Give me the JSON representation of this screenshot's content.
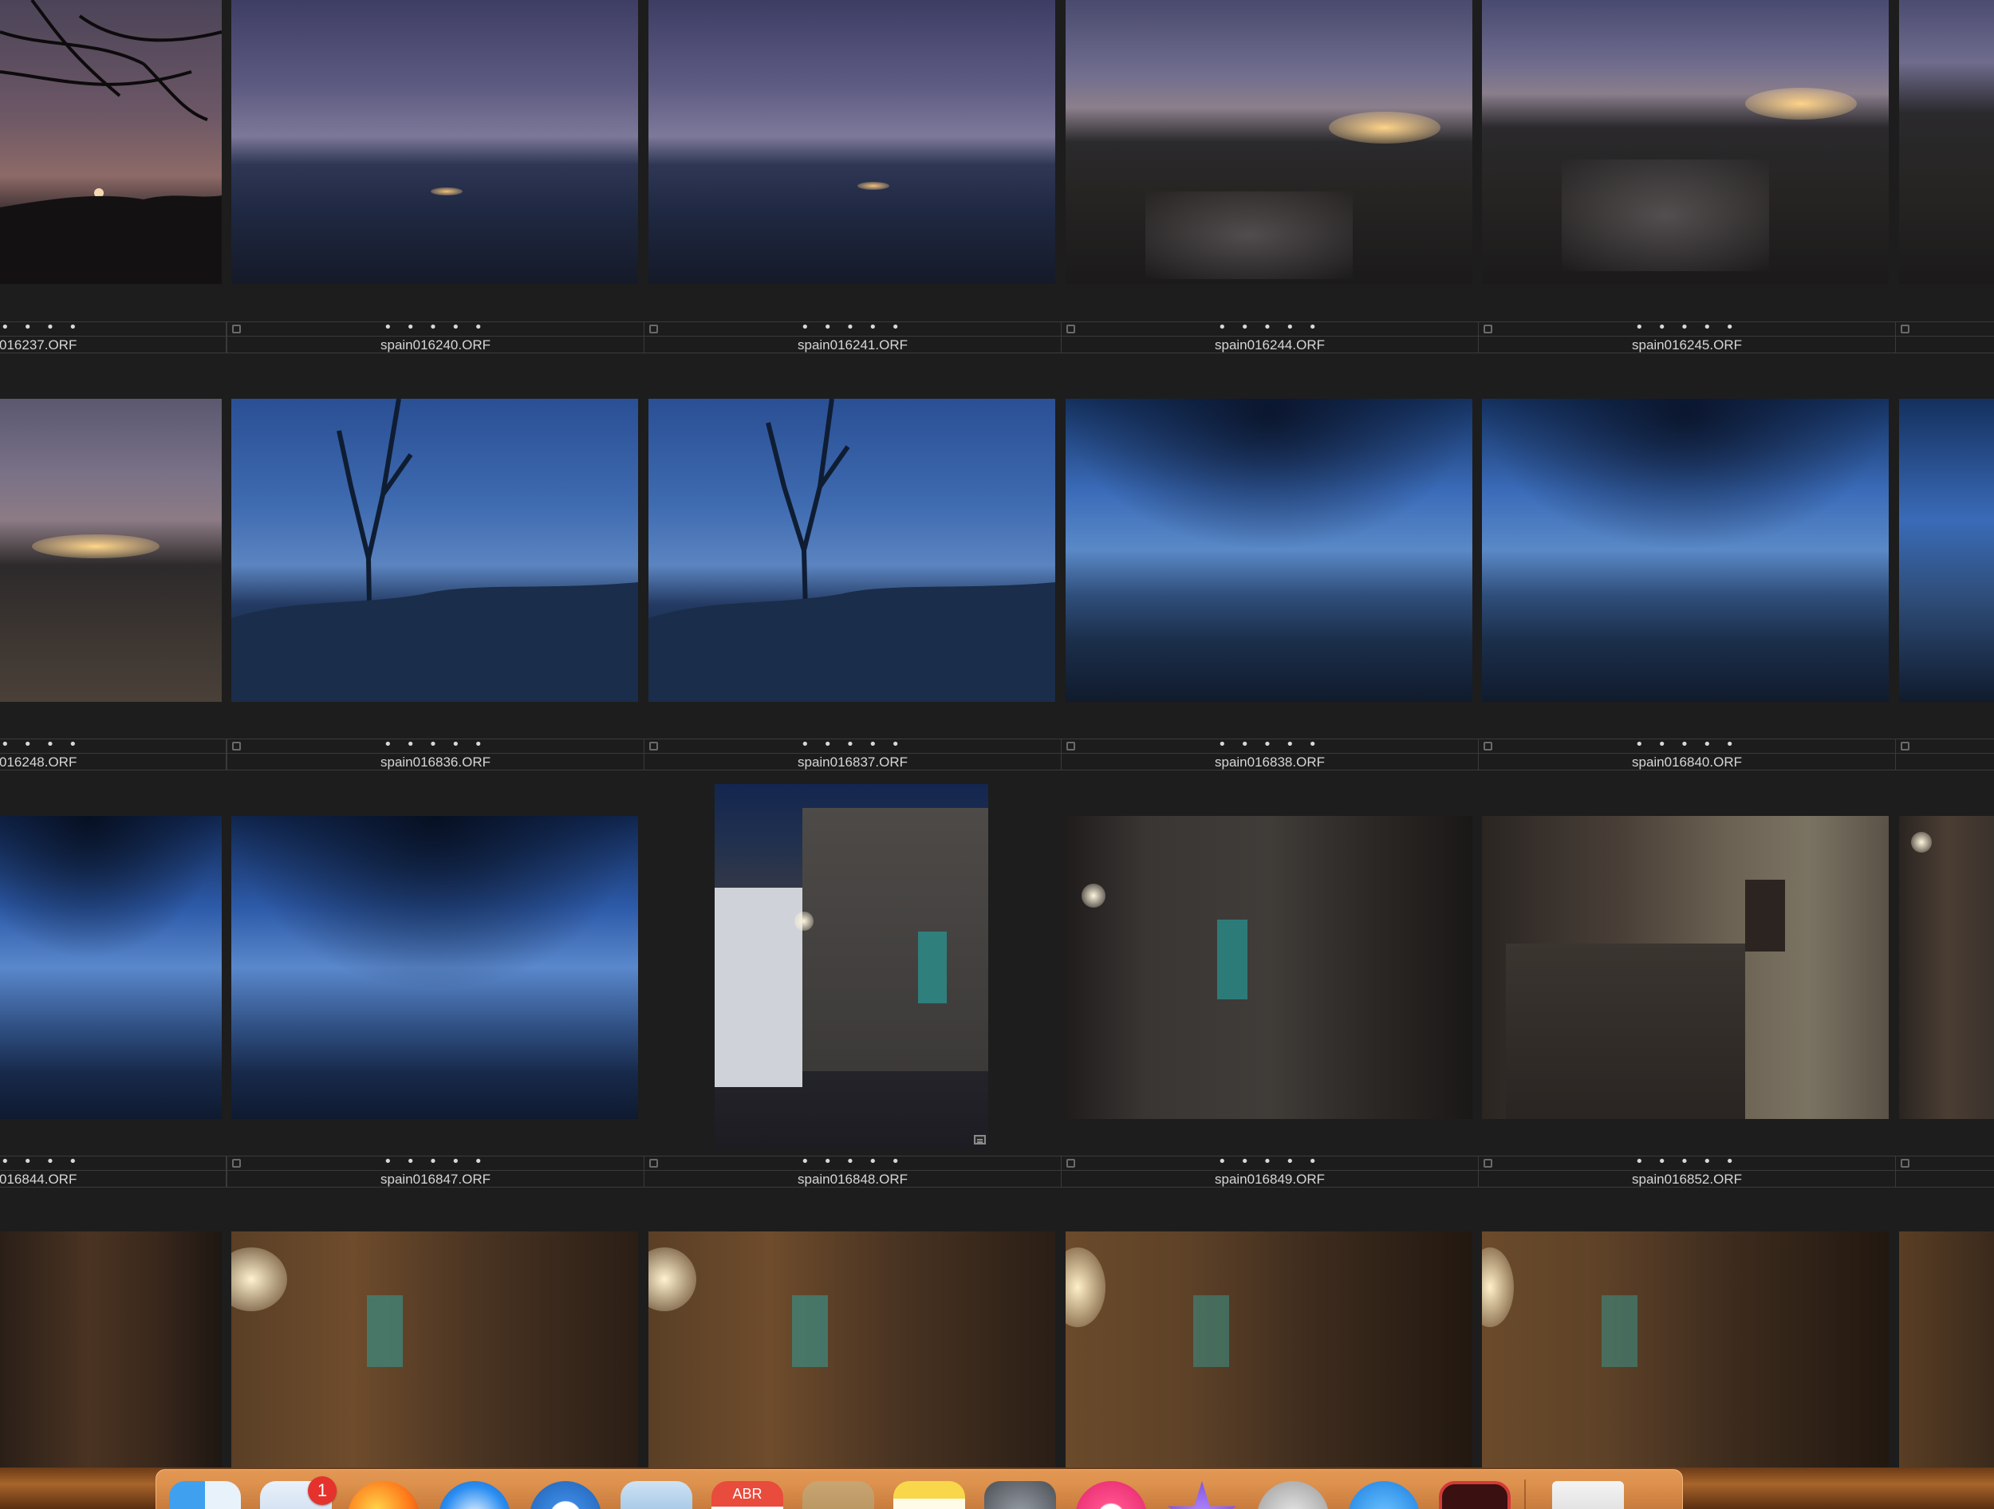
{
  "grid": {
    "rows": [
      {
        "cells": [
          {
            "filename": "016237.ORF",
            "rating": "• • • •",
            "clipped": true
          },
          {
            "filename": "spain016240.ORF",
            "rating": "• • • • •"
          },
          {
            "filename": "spain016241.ORF",
            "rating": "• • • • •"
          },
          {
            "filename": "spain016244.ORF",
            "rating": "• • • • •"
          },
          {
            "filename": "spain016245.ORF",
            "rating": "• • • • •"
          }
        ]
      },
      {
        "cells": [
          {
            "filename": "016248.ORF",
            "rating": "• • • •",
            "clipped": true
          },
          {
            "filename": "spain016836.ORF",
            "rating": "• • • • •"
          },
          {
            "filename": "spain016837.ORF",
            "rating": "• • • • •"
          },
          {
            "filename": "spain016838.ORF",
            "rating": "• • • • •"
          },
          {
            "filename": "spain016840.ORF",
            "rating": "• • • • •"
          }
        ]
      },
      {
        "cells": [
          {
            "filename": "016844.ORF",
            "rating": "• • • •",
            "clipped": true
          },
          {
            "filename": "spain016847.ORF",
            "rating": "• • • • •"
          },
          {
            "filename": "spain016848.ORF",
            "rating": "• • • • •"
          },
          {
            "filename": "spain016849.ORF",
            "rating": "• • • • •"
          },
          {
            "filename": "spain016852.ORF",
            "rating": "• • • • •"
          }
        ]
      }
    ]
  },
  "dock": {
    "mail_badge": "1",
    "calendar_month": "ABR",
    "icons": [
      "finder-icon",
      "mail-icon",
      "firefox-icon",
      "safari-icon",
      "onepassword-icon",
      "preview-icon",
      "calendar-icon",
      "contacts-icon",
      "notes-icon",
      "system-preferences-icon",
      "itunes-icon",
      "imovie-icon",
      "time-machine-icon",
      "app-store-icon",
      "terminal-icon",
      "trash-icon"
    ]
  },
  "colors": {
    "background": "#1d1d1d",
    "meta_border": "#3a3a3a",
    "text": "#d6d6d6",
    "dock": "#e39a55",
    "badge": "#e5322d"
  }
}
